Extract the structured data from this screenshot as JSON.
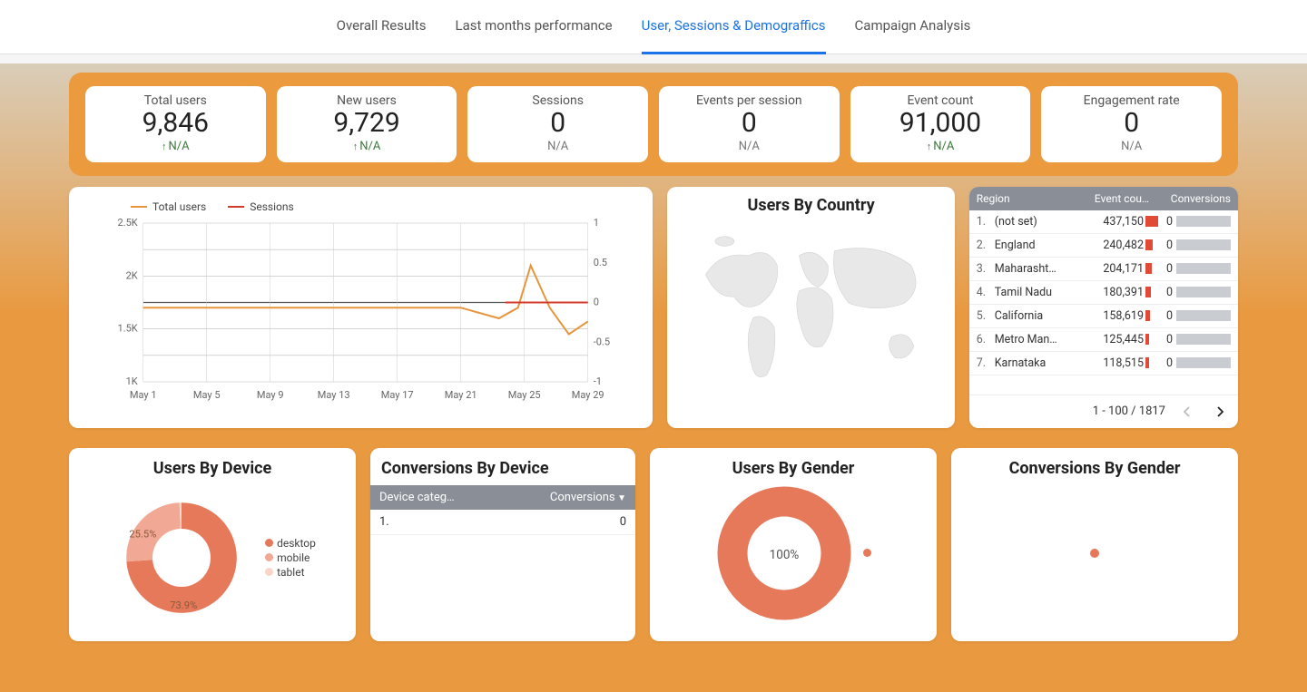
{
  "tabs": [
    {
      "label": "Overall Results",
      "active": false
    },
    {
      "label": "Last months performance",
      "active": false
    },
    {
      "label": "User, Sessions & Demograffics",
      "active": true
    },
    {
      "label": "Campaign Analysis",
      "active": false
    }
  ],
  "kpis": [
    {
      "label": "Total users",
      "value": "9,846",
      "delta": "N/A",
      "up": true
    },
    {
      "label": "New users",
      "value": "9,729",
      "delta": "N/A",
      "up": true
    },
    {
      "label": "Sessions",
      "value": "0",
      "delta": "N/A",
      "up": false
    },
    {
      "label": "Events per session",
      "value": "0",
      "delta": "N/A",
      "up": false
    },
    {
      "label": "Event count",
      "value": "91,000",
      "delta": "N/A",
      "up": true
    },
    {
      "label": "Engagement rate",
      "value": "0",
      "delta": "N/A",
      "up": false
    }
  ],
  "timeseries": {
    "legend": [
      "Total users",
      "Sessions"
    ],
    "x_ticks": [
      "May 1",
      "May 5",
      "May 9",
      "May 13",
      "May 17",
      "May 21",
      "May 25",
      "May 29"
    ],
    "y_left_ticks": [
      "2.5K",
      "2K",
      "1.5K",
      "1K"
    ],
    "y_right_ticks": [
      "1",
      "0.5",
      "0",
      "-0.5",
      "-1"
    ]
  },
  "map_title": "Users By Country",
  "region_table": {
    "headers": [
      "Region",
      "Event cou…",
      "Conversions"
    ],
    "rows": [
      {
        "idx": "1.",
        "region": "(not set)",
        "events": "437,150",
        "ev_w": 100,
        "conv": "0"
      },
      {
        "idx": "2.",
        "region": "England",
        "events": "240,482",
        "ev_w": 55,
        "conv": "0"
      },
      {
        "idx": "3.",
        "region": "Maharasht…",
        "events": "204,171",
        "ev_w": 47,
        "conv": "0"
      },
      {
        "idx": "4.",
        "region": "Tamil Nadu",
        "events": "180,391",
        "ev_w": 41,
        "conv": "0"
      },
      {
        "idx": "5.",
        "region": "California",
        "events": "158,619",
        "ev_w": 36,
        "conv": "0"
      },
      {
        "idx": "6.",
        "region": "Metro Man…",
        "events": "125,445",
        "ev_w": 29,
        "conv": "0"
      },
      {
        "idx": "7.",
        "region": "Karnataka",
        "events": "118,515",
        "ev_w": 27,
        "conv": "0"
      }
    ],
    "footer": "1 - 100 / 1817"
  },
  "users_by_device": {
    "title": "Users By Device",
    "slices": [
      {
        "label": "desktop",
        "pct": 73.9,
        "color": "#e5795a"
      },
      {
        "label": "mobile",
        "pct": 25.5,
        "color": "#f1a894"
      },
      {
        "label": "tablet",
        "pct": 0.6,
        "color": "#f8d6c9"
      }
    ]
  },
  "conv_by_device": {
    "title": "Conversions By Device",
    "headers": [
      "Device categ…",
      "Conversions"
    ],
    "rows": [
      {
        "idx": "1.",
        "val": "0"
      }
    ]
  },
  "users_by_gender": {
    "title": "Users By Gender",
    "center": "100%",
    "color": "#e5795a"
  },
  "conv_by_gender": {
    "title": "Conversions By Gender",
    "color": "#e5795a"
  },
  "chart_data": [
    {
      "type": "line",
      "name": "users_sessions_timeseries",
      "x": [
        "May 1",
        "May 5",
        "May 9",
        "May 13",
        "May 17",
        "May 21",
        "May 25",
        "May 29"
      ],
      "series": [
        {
          "name": "Total users",
          "axis": "left",
          "values": [
            1700,
            1700,
            1700,
            1700,
            1700,
            1700,
            2100,
            1550
          ]
        },
        {
          "name": "Sessions",
          "axis": "right",
          "values": [
            0,
            0,
            0,
            0,
            0,
            0,
            0,
            0
          ]
        }
      ],
      "y_left_lim": [
        1000,
        2500
      ],
      "y_right_lim": [
        -1,
        1
      ],
      "note": "Total users line is flat ~1.7K until ~May 23 then spikes to ~2.1K around May 25 and dips to ~1.45K before rising slightly; Sessions series is 0 and only appears over the final segment at y=0."
    },
    {
      "type": "pie",
      "name": "users_by_device",
      "donut": true,
      "categories": [
        "desktop",
        "mobile",
        "tablet"
      ],
      "values": [
        73.9,
        25.5,
        0.6
      ],
      "annotations": [
        "73.9%",
        "25.5%"
      ]
    },
    {
      "type": "pie",
      "name": "users_by_gender",
      "donut": true,
      "categories": [
        "(single segment)"
      ],
      "values": [
        100
      ],
      "annotations": [
        "100%"
      ]
    },
    {
      "type": "bar",
      "name": "region_event_counts",
      "categories": [
        "(not set)",
        "England",
        "Maharashtra",
        "Tamil Nadu",
        "California",
        "Metro Manila",
        "Karnataka"
      ],
      "values": [
        437150,
        240482,
        204171,
        180391,
        158619,
        125445,
        118515
      ],
      "secondary_series": {
        "name": "Conversions",
        "values": [
          0,
          0,
          0,
          0,
          0,
          0,
          0
        ]
      }
    }
  ]
}
